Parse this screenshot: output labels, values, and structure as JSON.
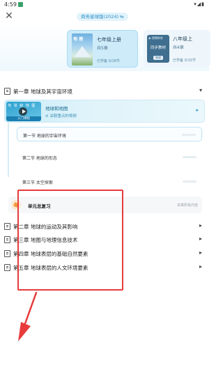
{
  "status_bar": {
    "time": "4:59",
    "icons": "▾◢▮"
  },
  "top_bar": {
    "close_icon": "close-icon",
    "edition_label": "商务星球版(2024) ⇆"
  },
  "books": [
    {
      "title": "七年级上册",
      "subtitle": "共5章",
      "progress": "已学备 0/18节",
      "cover_caption": "地 理",
      "active": true
    },
    {
      "title": "八年级上",
      "subtitle": "共4章",
      "progress": "已学备 0/15节",
      "cover_brand": "◉ 德腾教育",
      "cover_mid": "同步教材",
      "cover_tag": "地理",
      "active": false
    }
  ],
  "chapter_1": {
    "title": "第一章  地球及其宇宙环境",
    "expanded": true,
    "video": {
      "thumb_caption": "地 球 和 地 图",
      "thumb_footer": "入门课程",
      "title": "地球和地图",
      "subtitle": "⊘ 关联重点的视频"
    },
    "sections": [
      {
        "label": "第一节   地球的宇宙环境",
        "active": true
      },
      {
        "label": "第二节   地球的形态",
        "active": false
      },
      {
        "label": "第三节   太空探索",
        "active": false
      }
    ]
  },
  "unit_review": {
    "title": "单元总复习",
    "tag": "本章所有内容"
  },
  "chapters": [
    {
      "title": "第二章  地球的运动及其影响"
    },
    {
      "title": "第三章  地图与地理信息技术"
    },
    {
      "title": "第四章  地球表层的基础自然要素"
    },
    {
      "title": "第五章  地球表层的人文环境要素"
    }
  ],
  "colors": {
    "accent": "#2a8ec9",
    "annotation": "#e83b3b"
  }
}
